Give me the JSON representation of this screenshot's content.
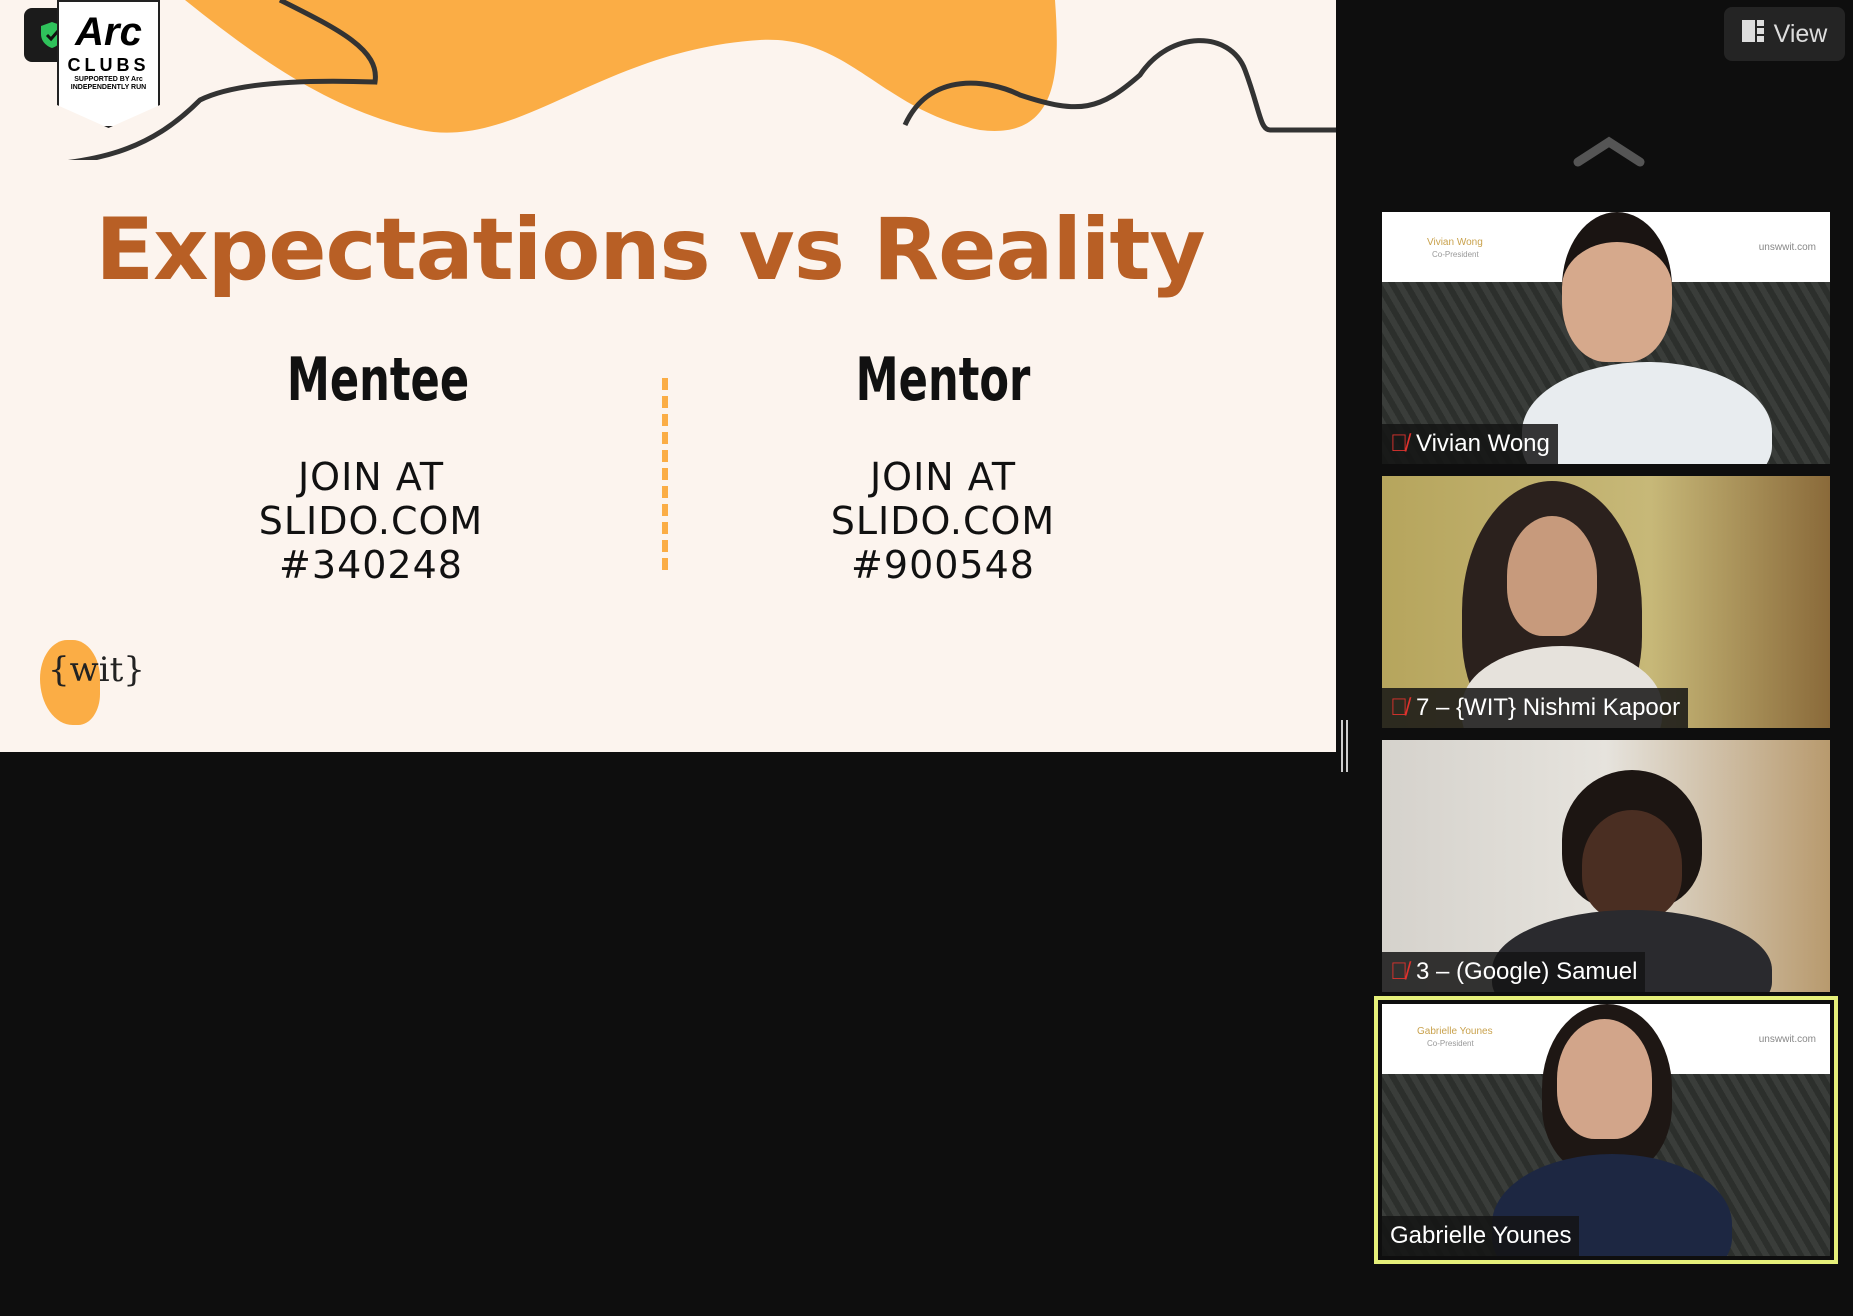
{
  "toolbar": {
    "view_label": "View"
  },
  "slide": {
    "logo_arc": "Arc",
    "logo_clubs": "CLUBS",
    "logo_sub1": "SUPPORTED BY Arc",
    "logo_sub2": "INDEPENDENTLY RUN",
    "title": "Expectations vs Reality",
    "columns": [
      {
        "heading": "Mentee",
        "lines": [
          "JOIN AT",
          "SLIDO.COM",
          "#340248"
        ]
      },
      {
        "heading": "Mentor",
        "lines": [
          "JOIN AT",
          "SLIDO.COM",
          "#900548"
        ]
      }
    ],
    "wit_logo": "{wit}"
  },
  "participants": [
    {
      "name": "Vivian Wong",
      "muted": true,
      "banner_name": "Vivian Wong",
      "banner_role": "Co-President",
      "banner_site": "unswwit.com"
    },
    {
      "name": "7 – {WIT} Nishmi Kapoor",
      "muted": true
    },
    {
      "name": "3 – (Google) Samuel",
      "muted": true
    },
    {
      "name": "Gabrielle Younes",
      "muted": false,
      "active_speaker": true,
      "banner_name": "Gabrielle Younes",
      "banner_role": "Co-President",
      "banner_site": "unswwit.com"
    }
  ],
  "colors": {
    "accent": "#b85f25",
    "orange": "#fbad45",
    "speaker_border": "#e6f07a",
    "mute": "#e0332e"
  }
}
